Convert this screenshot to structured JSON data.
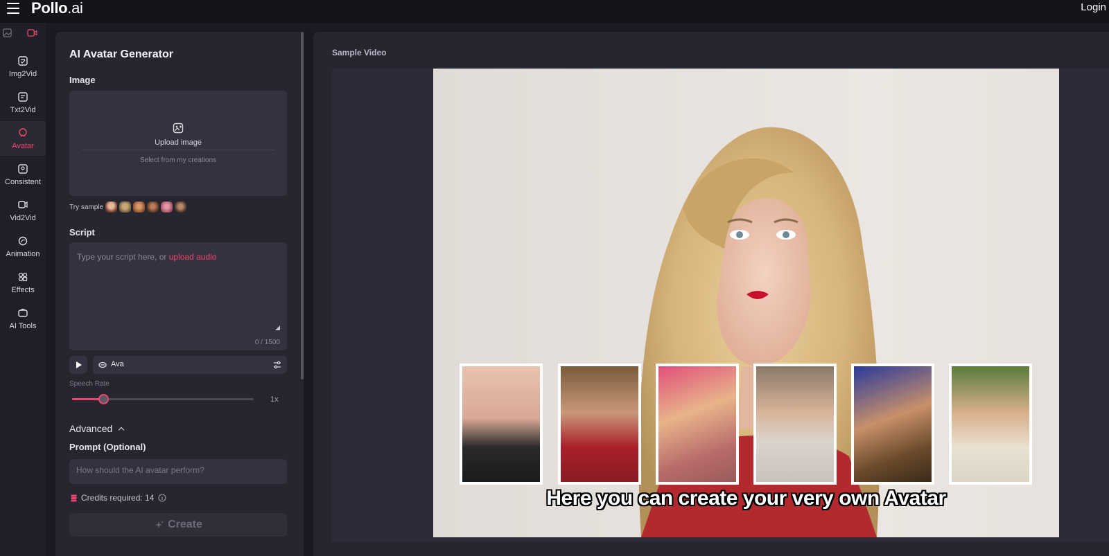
{
  "app": {
    "logo_main": "Pollo",
    "logo_suffix": ".ai",
    "login_label": "Login"
  },
  "rail": {
    "top_icons": [
      "image-icon",
      "video-icon"
    ],
    "items": [
      {
        "label": "Img2Vid",
        "icon": "img2vid-icon",
        "active": false
      },
      {
        "label": "Txt2Vid",
        "icon": "txt2vid-icon",
        "active": false
      },
      {
        "label": "Avatar",
        "icon": "avatar-icon",
        "active": true
      },
      {
        "label": "Consistent",
        "icon": "consistent-icon",
        "active": false
      },
      {
        "label": "Vid2Vid",
        "icon": "vid2vid-icon",
        "active": false
      },
      {
        "label": "Animation",
        "icon": "animation-icon",
        "active": false
      },
      {
        "label": "Effects",
        "icon": "effects-icon",
        "active": false
      },
      {
        "label": "AI Tools",
        "icon": "ai-tools-icon",
        "active": false
      }
    ]
  },
  "form": {
    "title": "AI Avatar Generator",
    "image_label": "Image",
    "upload_label": "Upload image",
    "select_creations_label": "Select from my creations",
    "try_sample_label": "Try sample",
    "script_label": "Script",
    "script_placeholder": "Type your script here, or ",
    "upload_audio_link": "upload audio",
    "char_count": "0 / 1500",
    "voice_name": "Ava",
    "speech_rate_label": "Speech Rate",
    "speech_rate_value": "1x",
    "speech_rate_fraction": 0.17,
    "advanced_label": "Advanced",
    "prompt_label": "Prompt (Optional)",
    "prompt_placeholder": "How should the AI avatar perform?",
    "credits_text": "Credits required: 14",
    "create_label": "Create"
  },
  "preview": {
    "title": "Sample Video",
    "caption": "Here you can create your very own Avatar"
  },
  "colors": {
    "accent": "#f0456f",
    "panel": "#262631",
    "field": "#33333f"
  }
}
